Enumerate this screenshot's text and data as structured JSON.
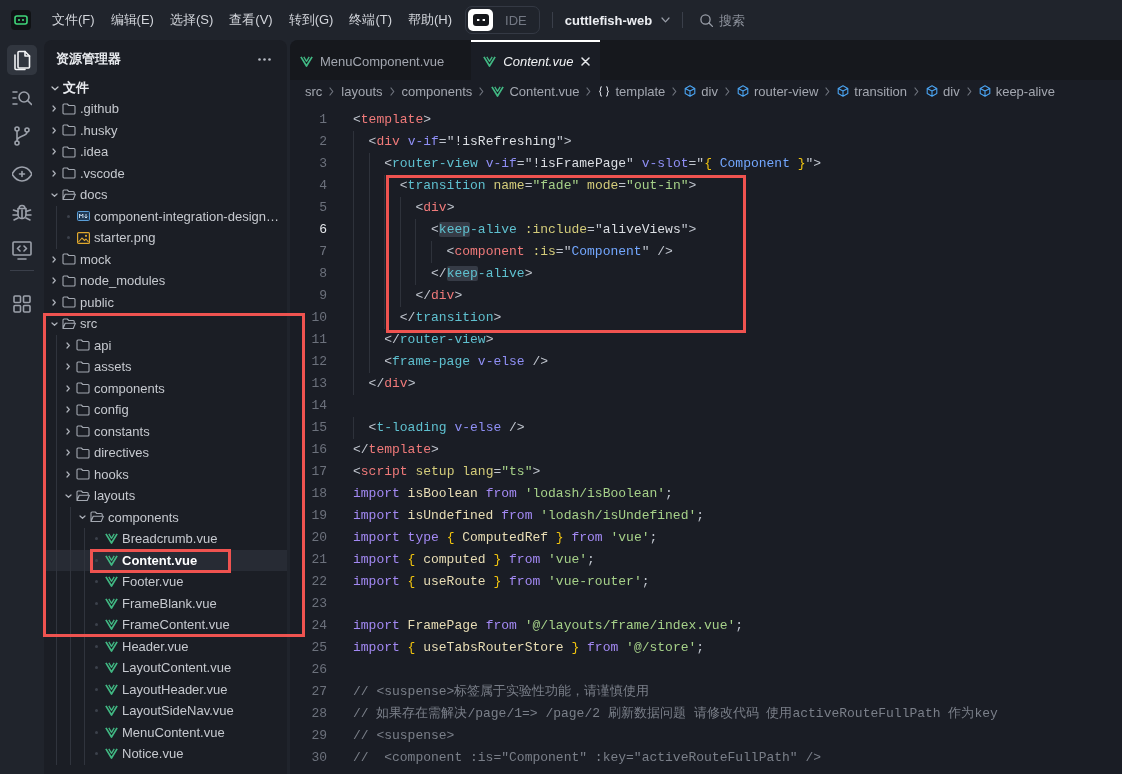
{
  "title_bar": {
    "menu": [
      "文件(F)",
      "编辑(E)",
      "选择(S)",
      "查看(V)",
      "转到(G)",
      "终端(T)",
      "帮助(H)"
    ],
    "mode_switch": [
      {
        "kind": "icon",
        "selected": true
      },
      {
        "kind": "text",
        "label": "IDE",
        "selected": false
      }
    ],
    "project": "cuttlefish-web",
    "search": {
      "placeholder": "搜索"
    }
  },
  "activity_bar": {
    "groups": [
      [
        {
          "kind": "explorer",
          "selected": true
        },
        {
          "kind": "search",
          "selected": false
        },
        {
          "kind": "source-control",
          "selected": false
        },
        {
          "kind": "preview",
          "selected": false
        },
        {
          "kind": "debug",
          "selected": false
        },
        {
          "kind": "remote",
          "selected": false
        }
      ],
      [
        {
          "kind": "extensions",
          "selected": false
        }
      ]
    ]
  },
  "explorer": {
    "title": "资源管理器",
    "section": {
      "title": "文件",
      "expanded": true
    },
    "tree": [
      {
        "label": ".github",
        "kind": "folder",
        "expanded": false,
        "selected": false
      },
      {
        "label": ".husky",
        "kind": "folder",
        "expanded": false,
        "selected": false
      },
      {
        "label": ".idea",
        "kind": "folder",
        "expanded": false,
        "selected": false
      },
      {
        "label": ".vscode",
        "kind": "folder",
        "expanded": false,
        "selected": false
      },
      {
        "label": "docs",
        "kind": "folder",
        "expanded": true,
        "selected": false,
        "children": [
          {
            "label": "component-integration-design…",
            "kind": "markdown",
            "selected": false
          },
          {
            "label": "starter.png",
            "kind": "image",
            "selected": false
          }
        ]
      },
      {
        "label": "mock",
        "kind": "folder",
        "expanded": false,
        "selected": false
      },
      {
        "label": "node_modules",
        "kind": "folder",
        "expanded": false,
        "selected": false
      },
      {
        "label": "public",
        "kind": "folder",
        "expanded": false,
        "selected": false
      },
      {
        "label": "src",
        "kind": "folder",
        "expanded": true,
        "selected": false,
        "boxed": true,
        "children": [
          {
            "label": "api",
            "kind": "folder",
            "expanded": false,
            "selected": false,
            "boxed": true
          },
          {
            "label": "assets",
            "kind": "folder",
            "expanded": false,
            "selected": false,
            "boxed": true
          },
          {
            "label": "components",
            "kind": "folder",
            "expanded": false,
            "selected": false,
            "boxed": true
          },
          {
            "label": "config",
            "kind": "folder",
            "expanded": false,
            "selected": false,
            "boxed": true
          },
          {
            "label": "constants",
            "kind": "folder",
            "expanded": false,
            "selected": false,
            "boxed": true
          },
          {
            "label": "directives",
            "kind": "folder",
            "expanded": false,
            "selected": false,
            "boxed": true
          },
          {
            "label": "hooks",
            "kind": "folder",
            "expanded": false,
            "selected": false,
            "boxed": true
          },
          {
            "label": "layouts",
            "kind": "folder",
            "expanded": true,
            "selected": false,
            "boxed": true,
            "children": [
              {
                "label": "components",
                "kind": "folder",
                "expanded": true,
                "selected": false,
                "boxed": true,
                "children": [
                  {
                    "label": "Breadcrumb.vue",
                    "kind": "vue",
                    "selected": false,
                    "boxed": true
                  },
                  {
                    "label": "Content.vue",
                    "kind": "vue",
                    "selected": true,
                    "boxed": true,
                    "marked": true
                  },
                  {
                    "label": "Footer.vue",
                    "kind": "vue",
                    "selected": false,
                    "boxed": true
                  },
                  {
                    "label": "FrameBlank.vue",
                    "kind": "vue",
                    "selected": false,
                    "boxed": true
                  },
                  {
                    "label": "FrameContent.vue",
                    "kind": "vue",
                    "selected": false,
                    "boxed": true
                  },
                  {
                    "label": "Header.vue",
                    "kind": "vue",
                    "selected": false
                  },
                  {
                    "label": "LayoutContent.vue",
                    "kind": "vue",
                    "selected": false
                  },
                  {
                    "label": "LayoutHeader.vue",
                    "kind": "vue",
                    "selected": false
                  },
                  {
                    "label": "LayoutSideNav.vue",
                    "kind": "vue",
                    "selected": false
                  },
                  {
                    "label": "MenuContent.vue",
                    "kind": "vue",
                    "selected": false
                  },
                  {
                    "label": "Notice.vue",
                    "kind": "vue",
                    "selected": false
                  }
                ]
              }
            ]
          }
        ]
      }
    ]
  },
  "editor": {
    "tabs": [
      {
        "label": "MenuComponent.vue",
        "kind": "vue",
        "selected": false,
        "preview": false
      },
      {
        "label": "Content.vue",
        "kind": "vue",
        "selected": true,
        "preview": true
      }
    ],
    "breadcrumb": [
      {
        "label": "src",
        "kind": "path"
      },
      {
        "label": "layouts",
        "kind": "path"
      },
      {
        "label": "components",
        "kind": "path"
      },
      {
        "label": "Content.vue",
        "kind": "vue"
      },
      {
        "label": "template",
        "kind": "block"
      },
      {
        "label": "div",
        "kind": "element"
      },
      {
        "label": "router-view",
        "kind": "element"
      },
      {
        "label": "transition",
        "kind": "element"
      },
      {
        "label": "div",
        "kind": "element"
      },
      {
        "label": "keep-alive",
        "kind": "element"
      }
    ],
    "lines": [
      {
        "number": "1",
        "current": false,
        "tokens": [
          {
            "kind": "punct",
            "text": "<"
          },
          {
            "kind": "tag",
            "text": "template"
          },
          {
            "kind": "punct",
            "text": ">"
          }
        ]
      },
      {
        "number": "2",
        "current": false,
        "tokens": [
          {
            "kind": "punct",
            "text": "  <"
          },
          {
            "kind": "tag",
            "text": "div "
          },
          {
            "kind": "directive",
            "text": "v-if"
          },
          {
            "kind": "punct",
            "text": "=\""
          },
          {
            "kind": "expression",
            "text": "!isRefreshing"
          },
          {
            "kind": "punct",
            "text": "\">"
          }
        ]
      },
      {
        "number": "3",
        "current": false,
        "tokens": [
          {
            "kind": "punct",
            "text": "    <"
          },
          {
            "kind": "component",
            "text": "router-view "
          },
          {
            "kind": "directive",
            "text": "v-if"
          },
          {
            "kind": "punct",
            "text": "=\""
          },
          {
            "kind": "expression",
            "text": "!isFramePage"
          },
          {
            "kind": "punct",
            "text": "\" "
          },
          {
            "kind": "directive",
            "text": "v-slot"
          },
          {
            "kind": "punct",
            "text": "=\""
          },
          {
            "kind": "brace",
            "text": "{ "
          },
          {
            "kind": "reference",
            "text": "Component "
          },
          {
            "kind": "brace",
            "text": "}"
          },
          {
            "kind": "punct",
            "text": "\">"
          }
        ]
      },
      {
        "number": "4",
        "current": false,
        "boxed": true,
        "tokens": [
          {
            "kind": "punct",
            "text": "      <"
          },
          {
            "kind": "component",
            "text": "transition "
          },
          {
            "kind": "attribute",
            "text": "name"
          },
          {
            "kind": "punct",
            "text": "="
          },
          {
            "kind": "string",
            "text": "\"fade\" "
          },
          {
            "kind": "attribute",
            "text": "mode"
          },
          {
            "kind": "punct",
            "text": "="
          },
          {
            "kind": "string",
            "text": "\"out-in\""
          },
          {
            "kind": "punct",
            "text": ">"
          }
        ]
      },
      {
        "number": "5",
        "current": false,
        "boxed": true,
        "tokens": [
          {
            "kind": "punct",
            "text": "        <"
          },
          {
            "kind": "tag",
            "text": "div"
          },
          {
            "kind": "punct",
            "text": ">"
          }
        ]
      },
      {
        "number": "6",
        "current": true,
        "boxed": true,
        "tokens": [
          {
            "kind": "punct",
            "text": "          <"
          },
          {
            "kind": "match",
            "text": "keep"
          },
          {
            "kind": "component",
            "text": "-alive "
          },
          {
            "kind": "attribute",
            "text": ":include"
          },
          {
            "kind": "punct",
            "text": "=\""
          },
          {
            "kind": "expression",
            "text": "aliveViews"
          },
          {
            "kind": "punct",
            "text": "\">"
          }
        ]
      },
      {
        "number": "7",
        "current": false,
        "boxed": true,
        "tokens": [
          {
            "kind": "punct",
            "text": "            <"
          },
          {
            "kind": "tag",
            "text": "component "
          },
          {
            "kind": "attribute",
            "text": ":is"
          },
          {
            "kind": "punct",
            "text": "=\""
          },
          {
            "kind": "reference",
            "text": "Component"
          },
          {
            "kind": "punct",
            "text": "\" />"
          }
        ]
      },
      {
        "number": "8",
        "current": false,
        "boxed": true,
        "tokens": [
          {
            "kind": "punct",
            "text": "          </"
          },
          {
            "kind": "match",
            "text": "keep"
          },
          {
            "kind": "component",
            "text": "-alive"
          },
          {
            "kind": "punct",
            "text": ">"
          }
        ]
      },
      {
        "number": "9",
        "current": false,
        "boxed": true,
        "tokens": [
          {
            "kind": "punct",
            "text": "        </"
          },
          {
            "kind": "tag",
            "text": "div"
          },
          {
            "kind": "punct",
            "text": ">"
          }
        ]
      },
      {
        "number": "10",
        "current": false,
        "boxed": true,
        "tokens": [
          {
            "kind": "punct",
            "text": "      </"
          },
          {
            "kind": "component",
            "text": "transition"
          },
          {
            "kind": "punct",
            "text": ">"
          }
        ]
      },
      {
        "number": "11",
        "current": false,
        "tokens": [
          {
            "kind": "punct",
            "text": "    </"
          },
          {
            "kind": "component",
            "text": "router-view"
          },
          {
            "kind": "punct",
            "text": ">"
          }
        ]
      },
      {
        "number": "12",
        "current": false,
        "tokens": [
          {
            "kind": "punct",
            "text": "    <"
          },
          {
            "kind": "component",
            "text": "frame-page "
          },
          {
            "kind": "directive",
            "text": "v-else"
          },
          {
            "kind": "punct",
            "text": " />"
          }
        ]
      },
      {
        "number": "13",
        "current": false,
        "tokens": [
          {
            "kind": "punct",
            "text": "  </"
          },
          {
            "kind": "tag",
            "text": "div"
          },
          {
            "kind": "punct",
            "text": ">"
          }
        ]
      },
      {
        "number": "14",
        "current": false
      },
      {
        "number": "15",
        "current": false,
        "tokens": [
          {
            "kind": "punct",
            "text": "  <"
          },
          {
            "kind": "component",
            "text": "t-loading "
          },
          {
            "kind": "directive",
            "text": "v-else"
          },
          {
            "kind": "punct",
            "text": " />"
          }
        ]
      },
      {
        "number": "16",
        "current": false,
        "tokens": [
          {
            "kind": "punct",
            "text": "</"
          },
          {
            "kind": "tag",
            "text": "template"
          },
          {
            "kind": "punct",
            "text": ">"
          }
        ]
      },
      {
        "number": "17",
        "current": false,
        "tokens": [
          {
            "kind": "punct",
            "text": "<"
          },
          {
            "kind": "tag",
            "text": "script "
          },
          {
            "kind": "attribute",
            "text": "setup lang"
          },
          {
            "kind": "punct",
            "text": "="
          },
          {
            "kind": "string",
            "text": "\"ts\""
          },
          {
            "kind": "punct",
            "text": ">"
          }
        ]
      },
      {
        "number": "18",
        "current": false,
        "tokens": [
          {
            "kind": "keyword",
            "text": "import "
          },
          {
            "kind": "identifier",
            "text": "isBoolean "
          },
          {
            "kind": "keyword",
            "text": "from "
          },
          {
            "kind": "string",
            "text": "'lodash/isBoolean'"
          },
          {
            "kind": "punct",
            "text": ";"
          }
        ]
      },
      {
        "number": "19",
        "current": false,
        "tokens": [
          {
            "kind": "keyword",
            "text": "import "
          },
          {
            "kind": "identifier",
            "text": "isUndefined "
          },
          {
            "kind": "keyword",
            "text": "from "
          },
          {
            "kind": "string",
            "text": "'lodash/isUndefined'"
          },
          {
            "kind": "punct",
            "text": ";"
          }
        ]
      },
      {
        "number": "20",
        "current": false,
        "tokens": [
          {
            "kind": "keyword",
            "text": "import type "
          },
          {
            "kind": "brace",
            "text": "{ "
          },
          {
            "kind": "identifier",
            "text": "ComputedRef "
          },
          {
            "kind": "brace",
            "text": "} "
          },
          {
            "kind": "keyword",
            "text": "from "
          },
          {
            "kind": "string",
            "text": "'vue'"
          },
          {
            "kind": "punct",
            "text": ";"
          }
        ]
      },
      {
        "number": "21",
        "current": false,
        "tokens": [
          {
            "kind": "keyword",
            "text": "import "
          },
          {
            "kind": "brace",
            "text": "{ "
          },
          {
            "kind": "identifier",
            "text": "computed "
          },
          {
            "kind": "brace",
            "text": "} "
          },
          {
            "kind": "keyword",
            "text": "from "
          },
          {
            "kind": "string",
            "text": "'vue'"
          },
          {
            "kind": "punct",
            "text": ";"
          }
        ]
      },
      {
        "number": "22",
        "current": false,
        "tokens": [
          {
            "kind": "keyword",
            "text": "import "
          },
          {
            "kind": "brace",
            "text": "{ "
          },
          {
            "kind": "identifier",
            "text": "useRoute "
          },
          {
            "kind": "brace",
            "text": "} "
          },
          {
            "kind": "keyword",
            "text": "from "
          },
          {
            "kind": "string",
            "text": "'vue-router'"
          },
          {
            "kind": "punct",
            "text": ";"
          }
        ]
      },
      {
        "number": "23",
        "current": false
      },
      {
        "number": "24",
        "current": false,
        "tokens": [
          {
            "kind": "keyword",
            "text": "import "
          },
          {
            "kind": "identifier",
            "text": "FramePage "
          },
          {
            "kind": "keyword",
            "text": "from "
          },
          {
            "kind": "string",
            "text": "'@/layouts/frame/index.vue'"
          },
          {
            "kind": "punct",
            "text": ";"
          }
        ]
      },
      {
        "number": "25",
        "current": false,
        "tokens": [
          {
            "kind": "keyword",
            "text": "import "
          },
          {
            "kind": "brace",
            "text": "{ "
          },
          {
            "kind": "identifier",
            "text": "useTabsRouterStore "
          },
          {
            "kind": "brace",
            "text": "} "
          },
          {
            "kind": "keyword",
            "text": "from "
          },
          {
            "kind": "string",
            "text": "'@/store'"
          },
          {
            "kind": "punct",
            "text": ";"
          }
        ]
      },
      {
        "number": "26",
        "current": false
      },
      {
        "number": "27",
        "current": false,
        "tokens": [
          {
            "kind": "comment",
            "text": "// <suspense>标签属于实验性功能，请谨慎使用"
          }
        ]
      },
      {
        "number": "28",
        "current": false,
        "tokens": [
          {
            "kind": "comment",
            "text": "// 如果存在需解决/page/1=> /page/2 刷新数据问题 请修改代码 使用activeRouteFullPath 作为key"
          }
        ]
      },
      {
        "number": "29",
        "current": false,
        "tokens": [
          {
            "kind": "comment",
            "text": "// <suspense>"
          }
        ]
      },
      {
        "number": "30",
        "current": false,
        "tokens": [
          {
            "kind": "comment",
            "text": "//  <component :is=\"Component\" :key=\"activeRouteFullPath\" />"
          }
        ]
      }
    ]
  }
}
